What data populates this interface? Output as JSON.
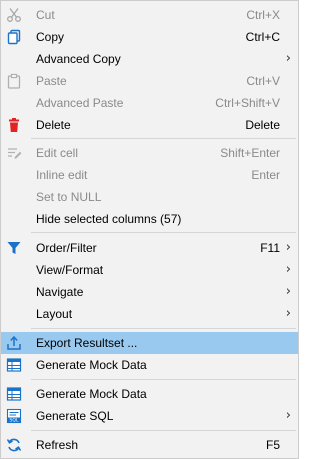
{
  "menu": {
    "cut": {
      "label": "Cut",
      "shortcut": "Ctrl+X",
      "icon": "scissors-icon"
    },
    "copy": {
      "label": "Copy",
      "shortcut": "Ctrl+C",
      "icon": "copy-icon"
    },
    "advanced_copy": {
      "label": "Advanced Copy",
      "arrow": "›"
    },
    "paste": {
      "label": "Paste",
      "shortcut": "Ctrl+V",
      "icon": "paste-icon"
    },
    "advanced_paste": {
      "label": "Advanced Paste",
      "shortcut": "Ctrl+Shift+V"
    },
    "delete": {
      "label": "Delete",
      "shortcut": "Delete",
      "icon": "trash-icon"
    },
    "edit_cell": {
      "label": "Edit cell",
      "shortcut": "Shift+Enter",
      "icon": "edit-icon"
    },
    "inline_edit": {
      "label": "Inline edit",
      "shortcut": "Enter"
    },
    "set_null": {
      "label": "Set to NULL"
    },
    "hide_columns": {
      "label": "Hide selected columns (57)"
    },
    "order_filter": {
      "label": "Order/Filter",
      "shortcut": "F11",
      "arrow": "›",
      "icon": "filter-icon"
    },
    "view_format": {
      "label": "View/Format",
      "arrow": "›"
    },
    "navigate": {
      "label": "Navigate",
      "arrow": "›"
    },
    "layout": {
      "label": "Layout",
      "arrow": "›"
    },
    "export": {
      "label": "Export Resultset ...",
      "icon": "export-icon"
    },
    "mock1": {
      "label": "Generate Mock Data",
      "icon": "table-icon"
    },
    "mock2": {
      "label": "Generate Mock Data",
      "icon": "table-icon"
    },
    "gen_sql": {
      "label": "Generate SQL",
      "arrow": "›",
      "icon": "sql-icon"
    },
    "refresh": {
      "label": "Refresh",
      "shortcut": "F5",
      "icon": "refresh-icon"
    }
  },
  "colors": {
    "highlight": "#99c9ef",
    "accent_blue": "#1a73c8",
    "delete_red": "#e02424",
    "disabled_text": "#8a8a8a"
  }
}
